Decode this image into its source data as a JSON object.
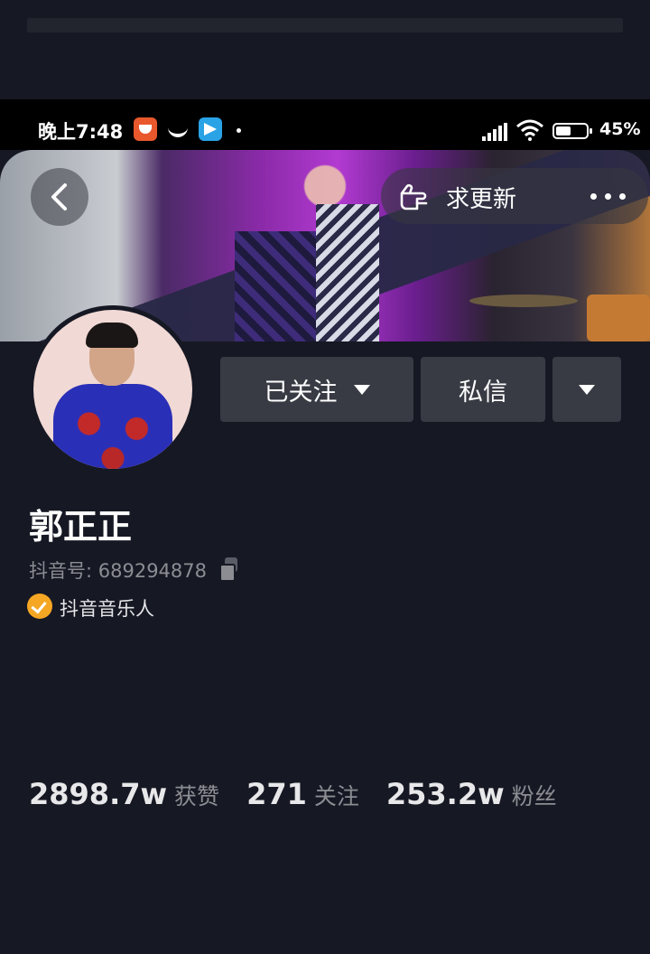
{
  "status_bar": {
    "time": "晚上7:48",
    "battery": "45%",
    "icons": [
      "fox-app-icon",
      "wave-icon",
      "telegram-icon",
      "dot-icon",
      "signal-icon",
      "wifi-icon",
      "battery-icon"
    ]
  },
  "header": {
    "request_update_label": "求更新",
    "icons": {
      "back": "chevron-left-icon",
      "request": "pointing-hand-icon",
      "more": "more-dots-icon"
    }
  },
  "actions": {
    "follow_label": "已关注",
    "message_label": "私信"
  },
  "profile": {
    "name": "郭正正",
    "douyin_id": "抖音号: 689294878",
    "verification": "抖音音乐人"
  },
  "stats": [
    {
      "value": "2898.7w",
      "label": "获赞"
    },
    {
      "value": "271",
      "label": "关注"
    },
    {
      "value": "253.2w",
      "label": "粉丝"
    }
  ],
  "colors": {
    "background": "#161823",
    "button": "#393b44",
    "verified": "#f5a623",
    "muted_text": "#8c8d93"
  }
}
